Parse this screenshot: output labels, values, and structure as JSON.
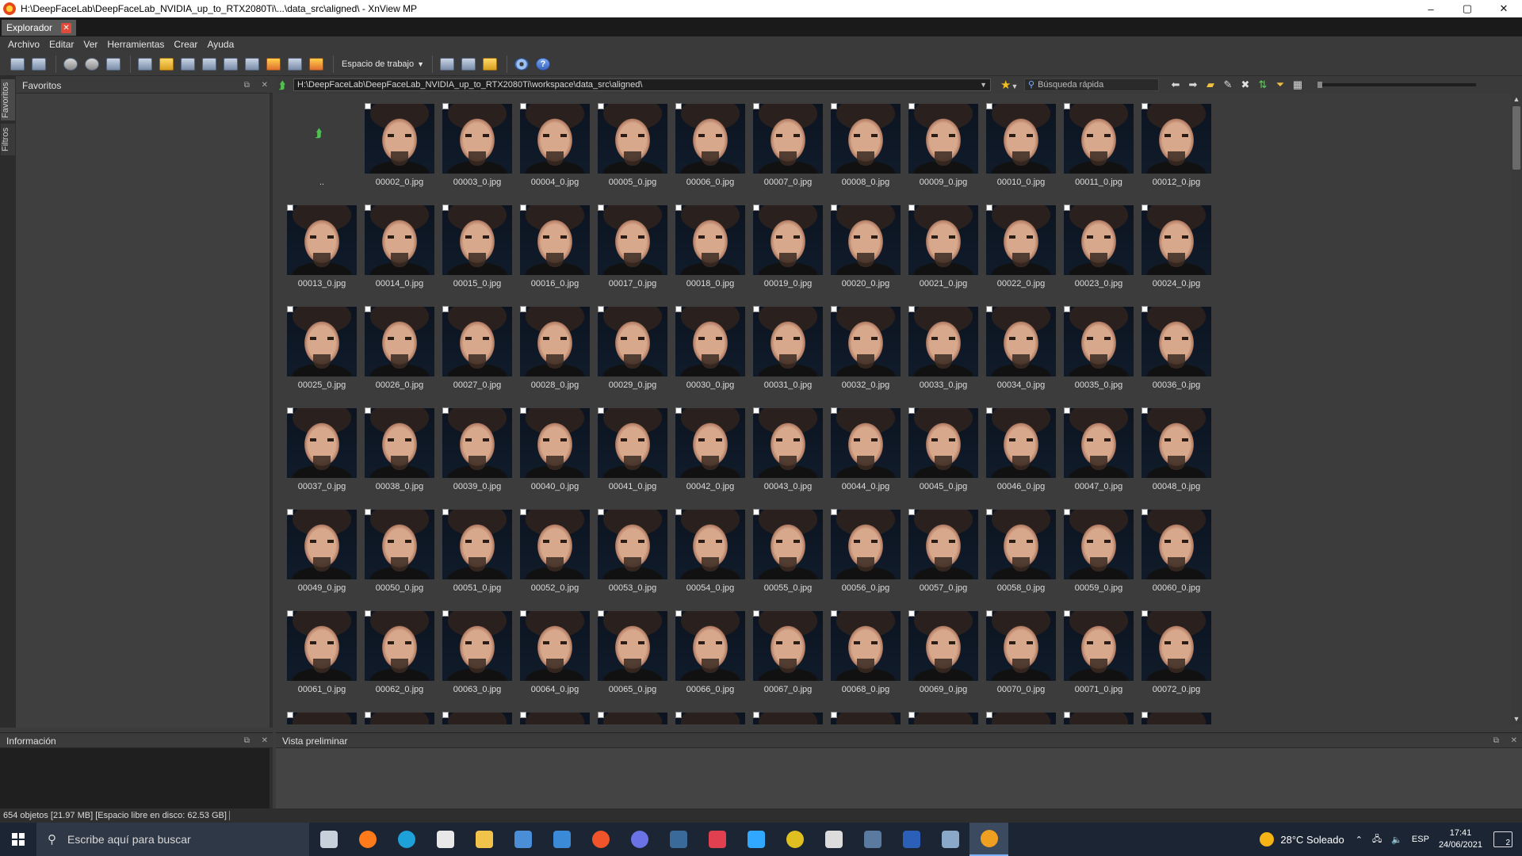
{
  "window": {
    "title": "H:\\DeepFaceLab\\DeepFaceLab_NVIDIA_up_to_RTX2080Ti\\...\\data_src\\aligned\\ - XnView MP",
    "minimize": "–",
    "maximize": "▢",
    "close": "✕"
  },
  "tab": {
    "label": "Explorador",
    "close": "✕"
  },
  "menu": [
    "Archivo",
    "Editar",
    "Ver",
    "Herramientas",
    "Crear",
    "Ayuda"
  ],
  "toolbar": {
    "workspace_label": "Espacio de trabajo",
    "help_glyph": "?"
  },
  "left_tabs": {
    "favorites": "Favoritos",
    "filters": "Filtros"
  },
  "favorites_panel": {
    "title": "Favoritos"
  },
  "address": {
    "path": "H:\\DeepFaceLab\\DeepFaceLab_NVIDIA_up_to_RTX2080Ti\\workspace\\data_src\\aligned\\",
    "search_placeholder": "Búsqueda rápida"
  },
  "parent_folder_label": "..",
  "files": [
    "00002_0.jpg",
    "00003_0.jpg",
    "00004_0.jpg",
    "00005_0.jpg",
    "00006_0.jpg",
    "00007_0.jpg",
    "00008_0.jpg",
    "00009_0.jpg",
    "00010_0.jpg",
    "00011_0.jpg",
    "00012_0.jpg",
    "00013_0.jpg",
    "00014_0.jpg",
    "00015_0.jpg",
    "00016_0.jpg",
    "00017_0.jpg",
    "00018_0.jpg",
    "00019_0.jpg",
    "00020_0.jpg",
    "00021_0.jpg",
    "00022_0.jpg",
    "00023_0.jpg",
    "00024_0.jpg",
    "00025_0.jpg",
    "00026_0.jpg",
    "00027_0.jpg",
    "00028_0.jpg",
    "00029_0.jpg",
    "00030_0.jpg",
    "00031_0.jpg",
    "00032_0.jpg",
    "00033_0.jpg",
    "00034_0.jpg",
    "00035_0.jpg",
    "00036_0.jpg",
    "00037_0.jpg",
    "00038_0.jpg",
    "00039_0.jpg",
    "00040_0.jpg",
    "00041_0.jpg",
    "00042_0.jpg",
    "00043_0.jpg",
    "00044_0.jpg",
    "00045_0.jpg",
    "00046_0.jpg",
    "00047_0.jpg",
    "00048_0.jpg",
    "00049_0.jpg",
    "00050_0.jpg",
    "00051_0.jpg",
    "00052_0.jpg",
    "00053_0.jpg",
    "00054_0.jpg",
    "00055_0.jpg",
    "00056_0.jpg",
    "00057_0.jpg",
    "00058_0.jpg",
    "00059_0.jpg",
    "00060_0.jpg",
    "00061_0.jpg",
    "00062_0.jpg",
    "00063_0.jpg",
    "00064_0.jpg",
    "00065_0.jpg",
    "00066_0.jpg",
    "00067_0.jpg",
    "00068_0.jpg",
    "00069_0.jpg",
    "00070_0.jpg",
    "00071_0.jpg",
    "00072_0.jpg"
  ],
  "info_panel": {
    "title": "Información"
  },
  "preview_panel": {
    "title": "Vista preliminar"
  },
  "status": "654 objetos [21.97 MB] [Espacio libre en disco: 62.53 GB]",
  "taskbar": {
    "search_placeholder": "Escribe aquí para buscar",
    "weather": "28°C  Soleado",
    "language": "ESP",
    "time": "17:41",
    "date": "24/06/2021",
    "notifications": "2",
    "apps": [
      "task-view",
      "firefox",
      "edge",
      "app-dark",
      "file-explorer",
      "store",
      "mail",
      "brave",
      "discord",
      "steam",
      "pen-app",
      "photoshop",
      "chrome",
      "game-app",
      "calculator",
      "word",
      "tool-app",
      "xnview"
    ]
  },
  "colors": {
    "accent": "#7ab4ff",
    "tab_close": "#e04a3a",
    "background": "#3c3c3c"
  }
}
